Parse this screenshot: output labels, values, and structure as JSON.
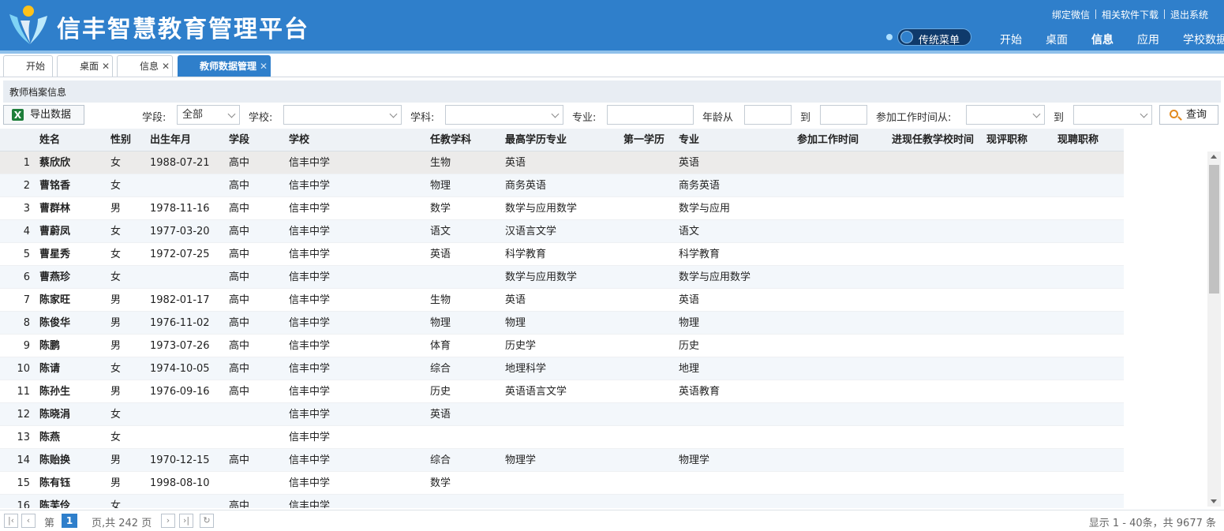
{
  "header": {
    "app_title": "信丰智慧教育管理平台",
    "links": [
      "绑定微信",
      "相关软件下载",
      "退出系统"
    ],
    "toggle_label": "传统菜单",
    "nav": [
      "开始",
      "桌面",
      "信息",
      "应用",
      "学校数据"
    ],
    "active_nav": "信息"
  },
  "tabs": [
    {
      "label": "开始",
      "closable": false
    },
    {
      "label": "桌面",
      "closable": true
    },
    {
      "label": "信息",
      "closable": true
    },
    {
      "label": "教师数据管理",
      "closable": true,
      "active": true
    }
  ],
  "panel": {
    "title": "教师档案信息"
  },
  "filters": {
    "export_label": "导出数据",
    "stage_label": "学段:",
    "stage_value": "全部",
    "school_label": "学校:",
    "school_value": "",
    "subject_label": "学科:",
    "subject_value": "",
    "major_label": "专业:",
    "major_value": "",
    "age_from_label": "年龄从",
    "age_to_label": "到",
    "work_from_label": "参加工作时间从:",
    "work_to_label": "到",
    "search_label": "查询"
  },
  "grid": {
    "columns": [
      "姓名",
      "性别",
      "出生年月",
      "学段",
      "学校",
      "任教学科",
      "最高学历专业",
      "第一学历",
      "专业",
      "参加工作时间",
      "进现任教学校时间",
      "现评职称",
      "现聘职称"
    ],
    "rows": [
      {
        "no": "1",
        "name": "蔡欣欣",
        "gender": "女",
        "birth": "1988-07-21",
        "stage": "高中",
        "school": "信丰中学",
        "subject": "生物",
        "top_major": "英语",
        "first_degree": "",
        "major": "英语"
      },
      {
        "no": "2",
        "name": "曹铭香",
        "gender": "女",
        "birth": "",
        "stage": "高中",
        "school": "信丰中学",
        "subject": "物理",
        "top_major": "商务英语",
        "first_degree": "",
        "major": "商务英语"
      },
      {
        "no": "3",
        "name": "曹群林",
        "gender": "男",
        "birth": "1978-11-16",
        "stage": "高中",
        "school": "信丰中学",
        "subject": "数学",
        "top_major": "数学与应用数学",
        "first_degree": "",
        "major": "数学与应用"
      },
      {
        "no": "4",
        "name": "曹蔚凤",
        "gender": "女",
        "birth": "1977-03-20",
        "stage": "高中",
        "school": "信丰中学",
        "subject": "语文",
        "top_major": "汉语言文学",
        "first_degree": "",
        "major": "语文"
      },
      {
        "no": "5",
        "name": "曹星秀",
        "gender": "女",
        "birth": "1972-07-25",
        "stage": "高中",
        "school": "信丰中学",
        "subject": "英语",
        "top_major": "科学教育",
        "first_degree": "",
        "major": "科学教育"
      },
      {
        "no": "6",
        "name": "曹燕珍",
        "gender": "女",
        "birth": "",
        "stage": "高中",
        "school": "信丰中学",
        "subject": "",
        "top_major": "数学与应用数学",
        "first_degree": "",
        "major": "数学与应用数学"
      },
      {
        "no": "7",
        "name": "陈家旺",
        "gender": "男",
        "birth": "1982-01-17",
        "stage": "高中",
        "school": "信丰中学",
        "subject": "生物",
        "top_major": "英语",
        "first_degree": "",
        "major": "英语"
      },
      {
        "no": "8",
        "name": "陈俊华",
        "gender": "男",
        "birth": "1976-11-02",
        "stage": "高中",
        "school": "信丰中学",
        "subject": "物理",
        "top_major": "物理",
        "first_degree": "",
        "major": "物理"
      },
      {
        "no": "9",
        "name": "陈鹏",
        "gender": "男",
        "birth": "1973-07-26",
        "stage": "高中",
        "school": "信丰中学",
        "subject": "体育",
        "top_major": "历史学",
        "first_degree": "",
        "major": "历史"
      },
      {
        "no": "10",
        "name": "陈请",
        "gender": "女",
        "birth": "1974-10-05",
        "stage": "高中",
        "school": "信丰中学",
        "subject": "综合",
        "top_major": "地理科学",
        "first_degree": "",
        "major": "地理"
      },
      {
        "no": "11",
        "name": "陈孙生",
        "gender": "男",
        "birth": "1976-09-16",
        "stage": "高中",
        "school": "信丰中学",
        "subject": "历史",
        "top_major": "英语语言文学",
        "first_degree": "",
        "major": "英语教育"
      },
      {
        "no": "12",
        "name": "陈晓涓",
        "gender": "女",
        "birth": "",
        "stage": "",
        "school": "信丰中学",
        "subject": "英语",
        "top_major": "",
        "first_degree": "",
        "major": ""
      },
      {
        "no": "13",
        "name": "陈燕",
        "gender": "女",
        "birth": "",
        "stage": "",
        "school": "信丰中学",
        "subject": "",
        "top_major": "",
        "first_degree": "",
        "major": ""
      },
      {
        "no": "14",
        "name": "陈贻换",
        "gender": "男",
        "birth": "1970-12-15",
        "stage": "高中",
        "school": "信丰中学",
        "subject": "综合",
        "top_major": "物理学",
        "first_degree": "",
        "major": "物理学"
      },
      {
        "no": "15",
        "name": "陈有钰",
        "gender": "男",
        "birth": "1998-08-10",
        "stage": "",
        "school": "信丰中学",
        "subject": "数学",
        "top_major": "",
        "first_degree": "",
        "major": ""
      },
      {
        "no": "16",
        "name": "陈芙伶",
        "gender": "女",
        "birth": "",
        "stage": "高中",
        "school": "信丰中学",
        "subject": "",
        "top_major": "",
        "first_degree": "",
        "major": ""
      }
    ]
  },
  "pager": {
    "page_prefix": "第",
    "current_page": "1",
    "page_suffix": "页,共 242 页",
    "summary": "显示 1 - 40条，共 9677 条"
  },
  "colors": {
    "brand": "#2f7fcb",
    "header_stripe": "#8fc0ea",
    "row_alt": "#f3f7fb",
    "row_selected": "#ecebea"
  }
}
